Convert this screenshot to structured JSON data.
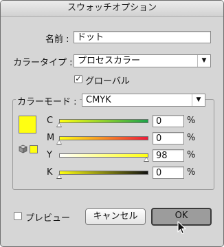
{
  "window": {
    "title": "スウォッチオプション"
  },
  "form": {
    "name_label": "名前 :",
    "name_value": "ドット",
    "color_type_label": "カラータイプ :",
    "color_type_value": "プロセスカラー",
    "global_label": "グローバル",
    "global_checked": true
  },
  "color_group": {
    "mode_label": "カラーモード :",
    "mode_value": "CMYK",
    "swatch_color": "#ffff12",
    "sliders": [
      {
        "label": "C",
        "value": "0",
        "unit": "%",
        "level": 0,
        "gradient": [
          "#ffff12",
          "#1ea24a"
        ]
      },
      {
        "label": "M",
        "value": "0",
        "unit": "%",
        "level": 0,
        "gradient": [
          "#ffff12",
          "#ee1a3a"
        ]
      },
      {
        "label": "Y",
        "value": "98",
        "unit": "%",
        "level": 98,
        "gradient": [
          "#ffffff",
          "#ffff12"
        ]
      },
      {
        "label": "K",
        "value": "0",
        "unit": "%",
        "level": 0,
        "gradient": [
          "#ffff12",
          "#111111"
        ]
      }
    ]
  },
  "footer": {
    "preview_label": "プレビュー",
    "preview_checked": false,
    "cancel_label": "キャンセル",
    "ok_label": "OK"
  },
  "icons": [
    "dropdown-arrow-icon",
    "checkmark-icon",
    "cube-icon",
    "mouse-cursor-icon"
  ]
}
